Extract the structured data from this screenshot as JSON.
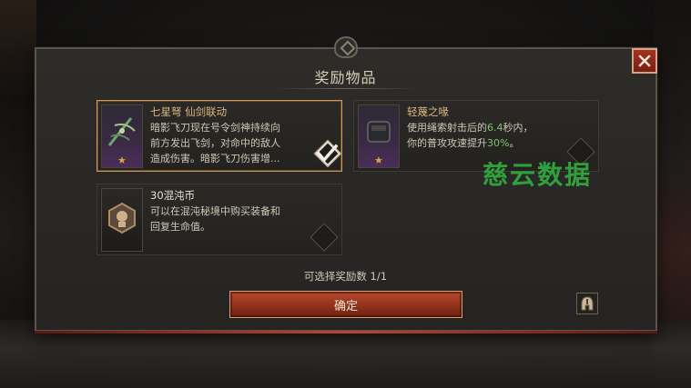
{
  "dialog": {
    "title": "奖励物品",
    "selection_count": "可选择奖励数 1/1",
    "confirm_label": "确定"
  },
  "rewards": [
    {
      "name": "七星弩 仙剑联动",
      "desc_lines": [
        "暗影飞刀现在号令剑神持续向",
        "前方发出飞剑，对命中的敌人",
        "造成伤害。暗影飞刀伤害增..."
      ],
      "selected": true,
      "rarity_icon": "star-icon"
    },
    {
      "name": "轻蔑之喙",
      "desc_line1_pre": "使用绳索射击后的",
      "desc_line1_val": "6.4",
      "desc_line1_post": "秒内，",
      "desc_line2_pre": "你的普攻攻速提升",
      "desc_line2_val": "30%",
      "desc_line2_post": "。",
      "selected": false,
      "rarity_icon": "star-icon"
    },
    {
      "name": "30混沌币",
      "desc_lines": [
        "可以在混沌秘境中购买装备和",
        "回复生命值。"
      ],
      "selected": false
    }
  ],
  "watermark": "慈云数据",
  "colors": {
    "accent_gold": "#c89a5c",
    "highlight_green": "#7ec76b",
    "button_red": "#8e3019",
    "watermark_green": "#2fa13c"
  }
}
